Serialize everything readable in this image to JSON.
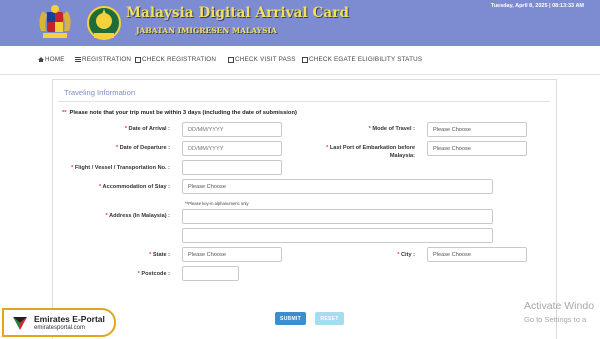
{
  "header": {
    "title": "Malaysia Digital Arrival Card",
    "subtitle": "JABATAN IMIGRESEN MALAYSIA",
    "datetime": "Tuesday, April 8, 2025 | 08:13:33 AM"
  },
  "nav": {
    "items": [
      {
        "label": "HOME",
        "icon": "home-icon"
      },
      {
        "label": "REGISTRATION",
        "icon": "list-icon"
      },
      {
        "label": "CHECK REGISTRATION",
        "icon": "form-icon"
      },
      {
        "label": "CHECK VISIT PASS",
        "icon": "form-icon"
      },
      {
        "label": "CHECK EGATE ELIGIBILITY STATUS",
        "icon": "form-icon"
      }
    ]
  },
  "form": {
    "section_title": "Traveling Information",
    "note_star": "**",
    "note": "Please note that your trip must be within 3 days (including the date of submission)",
    "required_mark": "*",
    "fields": {
      "date_of_arrival": {
        "label": "Date of Arrival :",
        "placeholder": "DD/MM/YYYY"
      },
      "mode_of_travel": {
        "label": "Mode of Travel :",
        "value": "Please Choose"
      },
      "date_of_departure": {
        "label": "Date of Departure :",
        "placeholder": "DD/MM/YYYY"
      },
      "last_port": {
        "label_line1": "Last Port of Embarkation before",
        "label_line2": "Malaysia:",
        "value": "Please Choose"
      },
      "flight_no": {
        "label": "Flight / Vessel / Transportation No. :",
        "value": ""
      },
      "accommodation": {
        "label": "Accommodation of Stay :",
        "value": "Please Choose"
      },
      "address_hint": "**Please key-in alphanumeric only",
      "address": {
        "label": "Address (In Malaysia) :",
        "line1": "",
        "line2": ""
      },
      "state": {
        "label": "State :",
        "value": "Please Choose"
      },
      "city": {
        "label": "City :",
        "value": "Please Choose"
      },
      "postcode": {
        "label": "Postcode :",
        "value": ""
      }
    },
    "buttons": {
      "submit": "SUBMIT",
      "reset": "RESET"
    }
  },
  "overlay": {
    "activate_line1": "Activate Windo",
    "activate_line2": "Go to Settings to a",
    "watermark_title": "Emirates E-Portal",
    "watermark_url": "emiratesportal.com"
  },
  "colors": {
    "header_bg": "#7d8cd1",
    "title_gold": "#f3e05a",
    "section_title": "#7a8fc8",
    "required_red": "#e03a3a",
    "submit_blue": "#3a8fd2",
    "reset_lightblue": "#a6dcef",
    "watermark_orange": "#e3a51a"
  }
}
